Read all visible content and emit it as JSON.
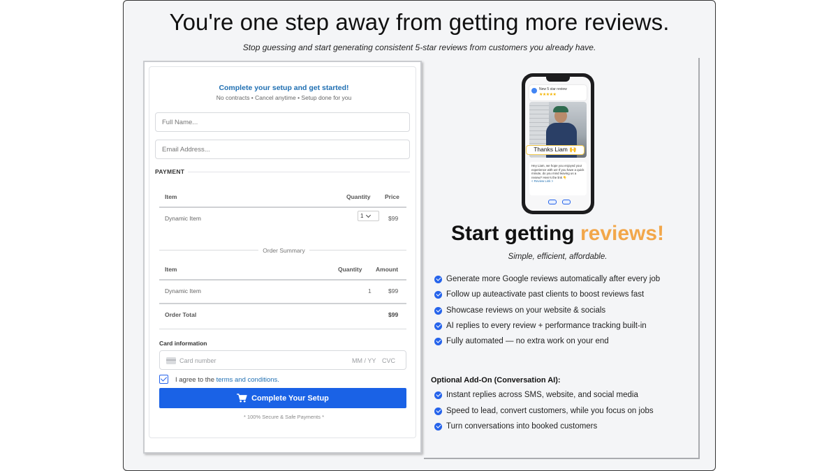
{
  "headline": "You're one step away from getting more reviews.",
  "subheadline": "Stop guessing and start generating consistent 5-star reviews from customers you already have.",
  "form": {
    "title": "Complete your setup and get started!",
    "subtitle": "No contracts • Cancel anytime • Setup done for you",
    "full_name_placeholder": "Full Name...",
    "email_placeholder": "Email Address...",
    "payment_label": "PAYMENT",
    "items_table": {
      "headers": [
        "Item",
        "Quantity",
        "Price"
      ],
      "rows": [
        {
          "item": "Dynamic Item",
          "quantity": "1",
          "price": "$99"
        }
      ]
    },
    "order_summary_label": "Order Summary",
    "summary_table": {
      "headers": [
        "Item",
        "Quantity",
        "Amount"
      ],
      "rows": [
        {
          "item": "Dynamic Item",
          "quantity": "1",
          "amount": "$99"
        }
      ],
      "total_label": "Order Total",
      "total_amount": "$99"
    },
    "card_label": "Card information",
    "card_number_placeholder": "Card number",
    "card_expiry_placeholder": "MM / YY",
    "card_cvc_placeholder": "CVC",
    "agree_prefix": "I agree to the ",
    "agree_link": "terms and conditions.",
    "agree_checked": true,
    "submit_label": "Complete Your Setup",
    "secure_note": "* 100% Secure & Safe Payments *"
  },
  "phone": {
    "notification_title": "New 5 star review",
    "stars": "★★★★★",
    "thanks_label": "Thanks Liam 🙌",
    "message": "Hey Liam, we hope you enjoyed your experience with us! If you have a quick minute, do you mind leaving us a review? Here's the link 👇",
    "review_link": "< Review Link >"
  },
  "right": {
    "title_prefix": "Start getting ",
    "title_accent": "reviews!",
    "tagline": "Simple, efficient, affordable.",
    "accent_color": "#f2a74b",
    "benefits": [
      "Generate more Google reviews automatically after every job",
      "Follow up auteactivate past clients to boost reviews fast",
      "Showcase reviews on your website & socials",
      "AI replies to every review + performance tracking built-in",
      "Fully automated — no extra work on your end"
    ],
    "addon_title": "Optional Add-On (Conversation AI):",
    "addon_benefits": [
      "Instant replies across SMS, website, and social media",
      "Speed to lead, convert customers, while you focus on jobs",
      "Turn conversations into booked customers"
    ]
  },
  "colors": {
    "primary_button": "#1a62e6",
    "link": "#1f6fb2",
    "check_icon": "#2563eb"
  }
}
